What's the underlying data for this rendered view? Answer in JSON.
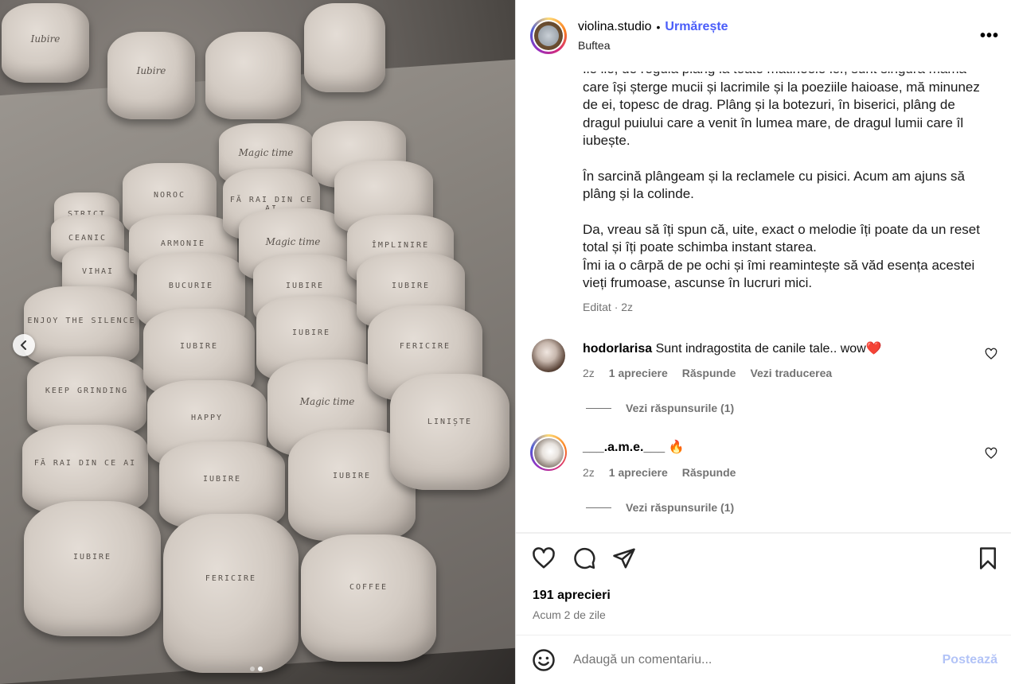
{
  "post": {
    "username": "violina.studio",
    "separator": "•",
    "follow_label": "Urmărește",
    "location": "Buftea",
    "more_label": "•••"
  },
  "media": {
    "cups": [
      {
        "text": "Iubire",
        "style": "script"
      },
      {
        "text": "Iubire",
        "style": "script"
      },
      {
        "text": "Magic time",
        "style": "script"
      },
      {
        "text": "STRICT",
        "style": "mono"
      },
      {
        "text": "NOROC",
        "style": "mono"
      },
      {
        "text": "FĂ RAI DIN CE AI",
        "style": "mono"
      },
      {
        "text": "CEANIC",
        "style": "mono"
      },
      {
        "text": "ARMONIE",
        "style": "mono"
      },
      {
        "text": "Magic time",
        "style": "script"
      },
      {
        "text": "ÎMPLINIRE",
        "style": "mono"
      },
      {
        "text": "VIHAI",
        "style": "mono"
      },
      {
        "text": "BUCURIE",
        "style": "mono"
      },
      {
        "text": "IUBIRE",
        "style": "mono"
      },
      {
        "text": "IUBIRE",
        "style": "mono"
      },
      {
        "text": "ENJOY THE SILENCE",
        "style": "mono"
      },
      {
        "text": "IUBIRE",
        "style": "mono"
      },
      {
        "text": "IUBIRE",
        "style": "mono"
      },
      {
        "text": "FERICIRE",
        "style": "mono"
      },
      {
        "text": "KEEP GRINDING",
        "style": "mono"
      },
      {
        "text": "HAPPY",
        "style": "mono"
      },
      {
        "text": "Magic time",
        "style": "script"
      },
      {
        "text": "LINIȘTE",
        "style": "mono"
      },
      {
        "text": "FĂ RAI DIN CE AI",
        "style": "mono"
      },
      {
        "text": "IUBIRE",
        "style": "mono"
      },
      {
        "text": "IUBIRE",
        "style": "mono"
      },
      {
        "text": "IUBIRE",
        "style": "mono"
      },
      {
        "text": "FERICIRE",
        "style": "mono"
      },
      {
        "text": "COFFEE",
        "style": "mono"
      }
    ],
    "slide_current": 2,
    "slide_total": 2
  },
  "caption": {
    "paragraphs": [
      "Ile ile, de regulă plâng la toate matineele lor, sunt singura mamă care își șterge mucii și lacrimile și la poeziile haioase, mă minunez de ei, topesc de drag. Plâng și la botezuri, în biserici, plâng de dragul puiului care a venit în lumea mare, de dragul lumii care îl iubește.",
      "În sarcină plângeam și la reclamele cu pisici. Acum am ajuns să plâng și la colinde.",
      "Da, vreau să îți spun că, uite, exact o melodie îți poate da un reset total și îți poate schimba instant starea.\nÎmi ia o cârpă de pe ochi și îmi reamintește să văd esența acestei vieți frumoase, ascunse în lucruri mici."
    ],
    "edited": "Editat · 2z"
  },
  "comments": [
    {
      "user": "hodorlarisa",
      "text": "Sunt indragostita de canile tale.. wow",
      "emoji": "❤️",
      "age": "2z",
      "likes": "1 apreciere",
      "reply": "Răspunde",
      "translate": "Vezi traducerea",
      "view_replies": "Vezi răspunsurile (1)"
    },
    {
      "user": "___.a.m.e.___",
      "text": "",
      "emoji": "🔥",
      "age": "2z",
      "likes": "1 apreciere",
      "reply": "Răspunde",
      "view_replies": "Vezi răspunsurile (1)"
    }
  ],
  "stats": {
    "likes": "191 aprecieri",
    "time": "Acum 2 de zile"
  },
  "composer": {
    "placeholder": "Adaugă un comentariu...",
    "post_label": "Postează"
  },
  "colors": {
    "follow": "#4a5df9",
    "post_disabled": "#b2c3f7",
    "secondary_text": "#737373"
  }
}
